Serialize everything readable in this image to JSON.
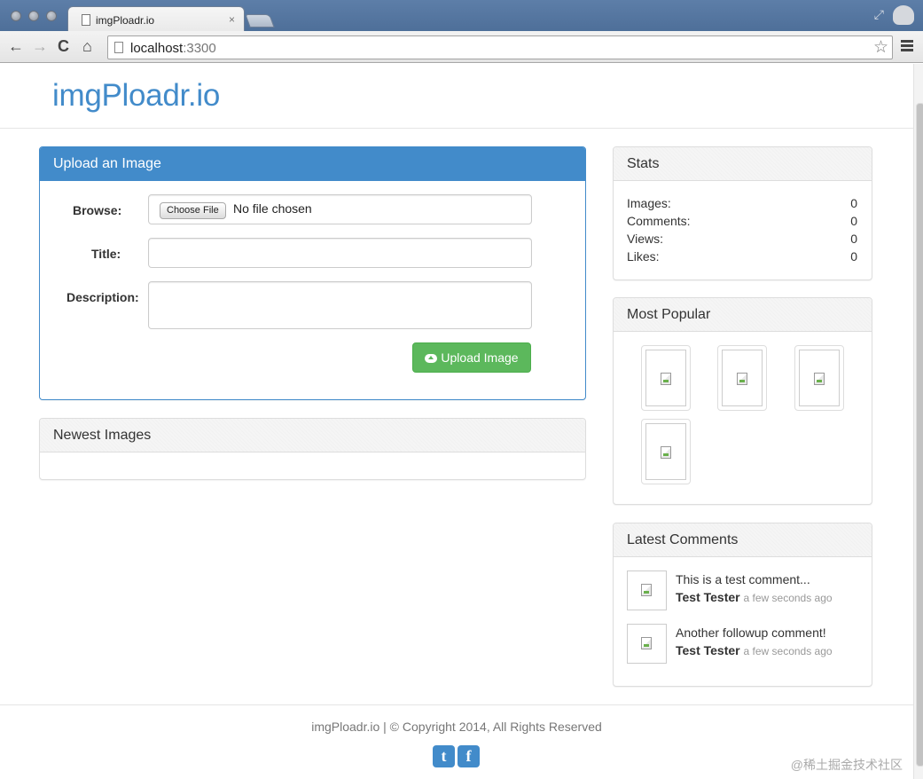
{
  "browser": {
    "tab_title": "imgPloadr.io",
    "tab_close": "×",
    "url_host": "localhost",
    "url_port": ":3300",
    "back": "←",
    "forward": "→",
    "reload": "C",
    "home": "⌂",
    "star": "☆"
  },
  "header": {
    "brand": "imgPloadr.io"
  },
  "upload_panel": {
    "heading": "Upload an Image",
    "browse_label": "Browse:",
    "choose_file_label": "Choose File",
    "no_file_text": "No file chosen",
    "title_label": "Title:",
    "title_value": "",
    "description_label": "Description:",
    "description_value": "",
    "submit_label": "Upload Image"
  },
  "newest_panel": {
    "heading": "Newest Images"
  },
  "stats_panel": {
    "heading": "Stats",
    "rows": [
      {
        "label": "Images:",
        "value": "0"
      },
      {
        "label": "Comments:",
        "value": "0"
      },
      {
        "label": "Views:",
        "value": "0"
      },
      {
        "label": "Likes:",
        "value": "0"
      }
    ]
  },
  "popular_panel": {
    "heading": "Most Popular"
  },
  "comments_panel": {
    "heading": "Latest Comments",
    "items": [
      {
        "text": "This is a test comment...",
        "author": "Test Tester",
        "time": "a few seconds ago"
      },
      {
        "text": "Another followup comment!",
        "author": "Test Tester",
        "time": "a few seconds ago"
      }
    ]
  },
  "footer": {
    "text": "imgPloadr.io | © Copyright 2014, All Rights Reserved",
    "twitter_glyph": "t",
    "facebook_glyph": "f"
  },
  "watermark": "@稀土掘金技术社区",
  "colors": {
    "primary": "#428bca",
    "success": "#5cb85c",
    "chrome": "#5d7ea8"
  }
}
